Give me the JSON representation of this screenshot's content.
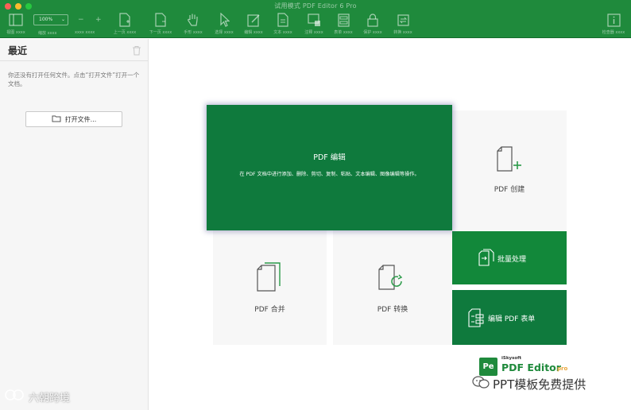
{
  "window": {
    "title": "试用模式 PDF Editor 6 Pro"
  },
  "toolbar": {
    "zoom_value": "100%",
    "items": [
      {
        "label": "视图 xxxx",
        "icon": "sidebar-view-icon"
      },
      {
        "label": "缩放 xxxx",
        "icon": "zoom-icon"
      },
      {
        "label": "xxxx xxxx",
        "icon": "zoom-out-icon"
      },
      {
        "label": "上一页 xxxx",
        "icon": "page-up-icon"
      },
      {
        "label": "下一页 xxxx",
        "icon": "page-down-icon"
      },
      {
        "label": "手形 xxxx",
        "icon": "hand-icon"
      },
      {
        "label": "选择 xxxx",
        "icon": "select-arrow-icon"
      },
      {
        "label": "编辑 xxxx",
        "icon": "edit-icon"
      },
      {
        "label": "文本 xxxx",
        "icon": "text-icon"
      },
      {
        "label": "注释 xxxx",
        "icon": "comment-icon"
      },
      {
        "label": "表单 xxxx",
        "icon": "form-icon"
      },
      {
        "label": "保护 xxxx",
        "icon": "lock-icon"
      },
      {
        "label": "转换 xxxx",
        "icon": "convert-icon"
      },
      {
        "label": "检查器 xxxx",
        "icon": "inspector-icon"
      }
    ]
  },
  "sidebar": {
    "title": "最近",
    "hint": "你还没有打开任何文件。点击“打开文件”打开一个文档。",
    "open_button": "打开文件..."
  },
  "cards": {
    "edit": {
      "title": "PDF 编辑",
      "description": "在 PDF 文档中进行添加、删除、剪切、复制、粘贴、文本编辑、图像编辑等操作。"
    },
    "create": {
      "title": "PDF 创建"
    },
    "merge": {
      "title": "PDF 合并"
    },
    "convert": {
      "title": "PDF 转换"
    },
    "batch": {
      "title": "批量处理"
    },
    "form": {
      "title": "编辑 PDF 表单"
    }
  },
  "logo": {
    "badge": "Pe",
    "brand": "iSkysoft",
    "name": "PDF Editor",
    "edition": "pro"
  },
  "watermarks": {
    "right": "PPT模板免费提供",
    "left": "六朝跨境"
  },
  "colors": {
    "brand_green": "#1f8a3c",
    "hero_green": "#0f7a3d",
    "accent_orange": "#e8a53a"
  }
}
